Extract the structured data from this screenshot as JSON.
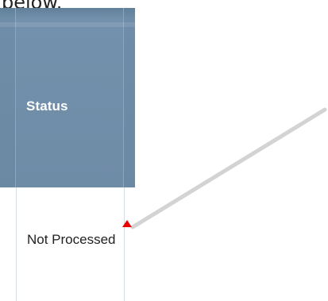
{
  "caption": {
    "text": "below."
  },
  "grid": {
    "column_header": "Status",
    "cell_value": "Not Processed",
    "header_color": "#6f8ea9",
    "text_color": "#222222"
  },
  "annotation": {
    "marker_color": "#e60000",
    "line_color": "#d3d3d3"
  }
}
